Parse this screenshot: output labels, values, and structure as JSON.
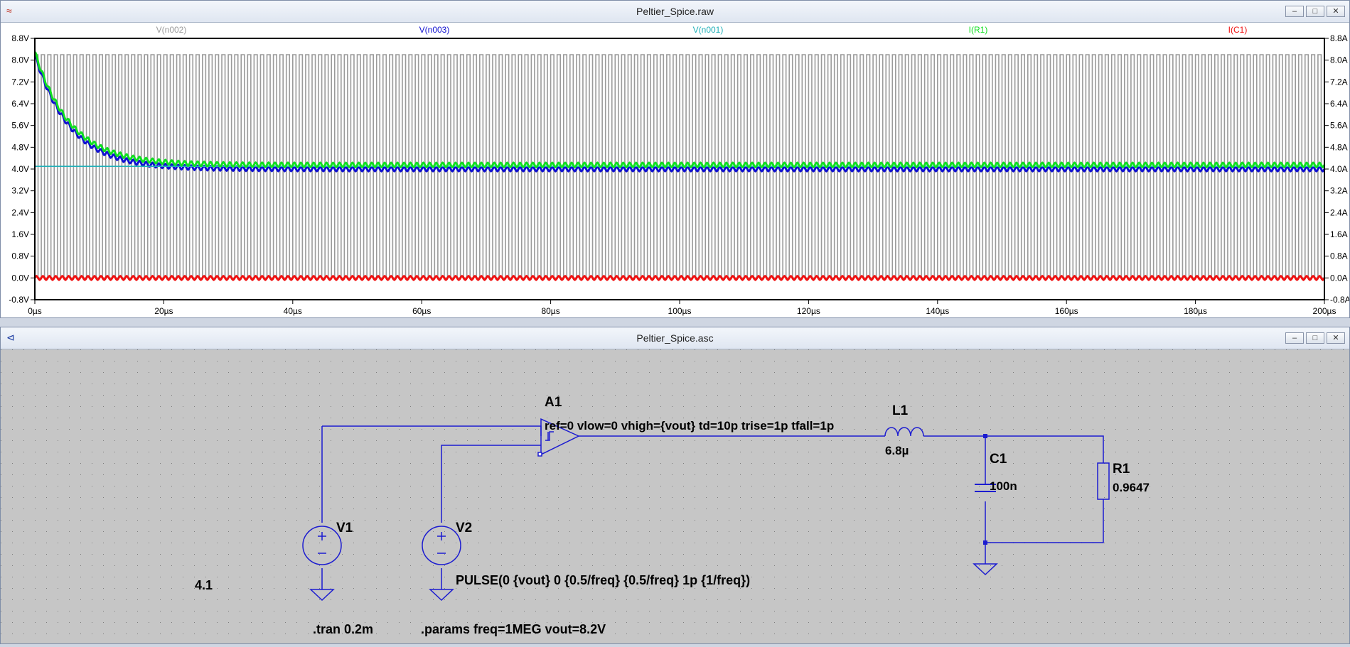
{
  "plot_window": {
    "title": "Peltier_Spice.raw",
    "buttons": [
      "minimize",
      "restore",
      "close"
    ]
  },
  "schematic_window": {
    "title": "Peltier_Spice.asc",
    "buttons": [
      "minimize",
      "restore",
      "close"
    ],
    "components": {
      "A1": {
        "name": "A1",
        "params": "ref=0 vlow=0 vhigh={vout} td=10p trise=1p tfall=1p"
      },
      "L1": {
        "name": "L1",
        "value": "6.8µ"
      },
      "C1": {
        "name": "C1",
        "value": "100n"
      },
      "R1": {
        "name": "R1",
        "value": "0.9647"
      },
      "V1": {
        "name": "V1",
        "value": "4.1"
      },
      "V2": {
        "name": "V2",
        "value": "PULSE(0 {vout} 0 {0.5/freq} {0.5/freq} 1p {1/freq})"
      }
    },
    "directives": {
      "tran": ".tran 0.2m",
      "params": ".params freq=1MEG vout=8.2V"
    }
  },
  "chart_data": {
    "type": "line",
    "x_ticks": [
      "0µs",
      "20µs",
      "40µs",
      "60µs",
      "80µs",
      "100µs",
      "120µs",
      "140µs",
      "160µs",
      "180µs",
      "200µs"
    ],
    "left_ticks": [
      "8.8V",
      "8.0V",
      "7.2V",
      "6.4V",
      "5.6V",
      "4.8V",
      "4.0V",
      "3.2V",
      "2.4V",
      "1.6V",
      "0.8V",
      "0.0V",
      "-0.8V"
    ],
    "right_ticks": [
      "8.8A",
      "8.0A",
      "7.2A",
      "6.4A",
      "5.6A",
      "4.8A",
      "4.0A",
      "3.2A",
      "2.4A",
      "1.6A",
      "0.8A",
      "0.0A",
      "-0.8A"
    ],
    "xlim": [
      0,
      200
    ],
    "ylim": [
      -0.8,
      8.8
    ],
    "series": [
      {
        "name": "V(n002)",
        "color": "#9a9a9a",
        "kind": "pulse",
        "low": 0.0,
        "high": 8.2,
        "period": 1.0
      },
      {
        "name": "V(n003)",
        "color": "#1010d0",
        "kind": "decay",
        "start": 8.2,
        "final": 4.0,
        "tau": 5.5,
        "ripple": 0.08
      },
      {
        "name": "V(n001)",
        "color": "#20b0b8",
        "kind": "constant",
        "value": 4.1
      },
      {
        "name": "I(R1)",
        "color": "#10e020",
        "kind": "decay",
        "start": 8.3,
        "final": 4.15,
        "tau": 5.5,
        "ripple": 0.08
      },
      {
        "name": "I(C1)",
        "color": "#f01010",
        "kind": "ripple",
        "value": 0.0,
        "ripple": 0.07
      }
    ]
  }
}
